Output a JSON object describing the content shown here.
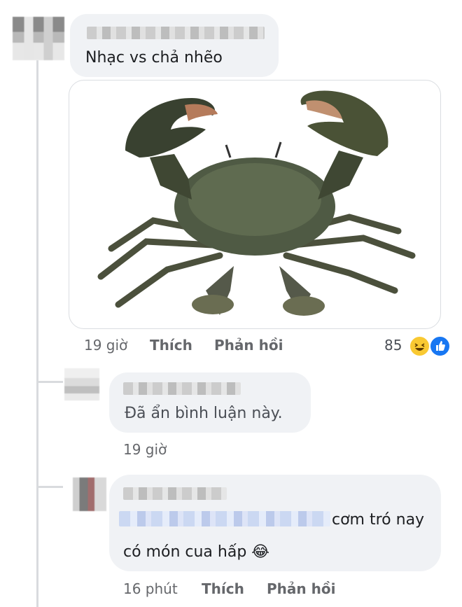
{
  "comment1": {
    "text": "Nhạc vs chả nhẽo",
    "time": "19 giờ",
    "like_label": "Thích",
    "reply_label": "Phản hồi",
    "reaction_count": "85",
    "reaction_icons": [
      "haha-icon",
      "like-icon"
    ]
  },
  "reply1": {
    "text": "Đã ẩn bình luận này.",
    "time": "19 giờ"
  },
  "reply2": {
    "text_line1": "cơm tró nay",
    "text_line2": "có món cua hấp",
    "emoji": "😂",
    "time": "16 phút",
    "like_label": "Thích",
    "reply_label": "Phản hồi"
  },
  "colors": {
    "bubble": "#f0f2f5",
    "meta": "#65676b",
    "like_blue": "#1877f2",
    "haha_yellow": "#f9c932"
  }
}
